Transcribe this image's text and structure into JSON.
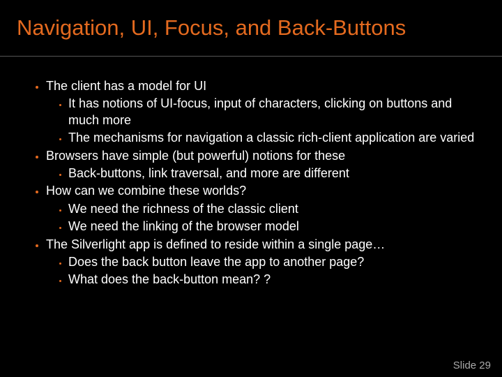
{
  "title": "Navigation, UI, Focus, and Back-Buttons",
  "bullets": {
    "b0": "The client has a model for UI",
    "b0s0": "It has notions of UI-focus, input of characters, clicking on buttons and much more",
    "b0s1": "The mechanisms for navigation a classic rich-client application are varied",
    "b1": "Browsers have simple (but powerful) notions for these",
    "b1s0": "Back-buttons, link traversal, and more are different",
    "b2": "How can we combine these worlds?",
    "b2s0": "We need the richness of the classic client",
    "b2s1": "We need the linking of the browser model",
    "b3": "The Silverlight app is defined to reside within a single page…",
    "b3s0": "Does the back button leave the app to another page?",
    "b3s1": "What does the back-button mean? ?"
  },
  "footer": "Slide 29"
}
